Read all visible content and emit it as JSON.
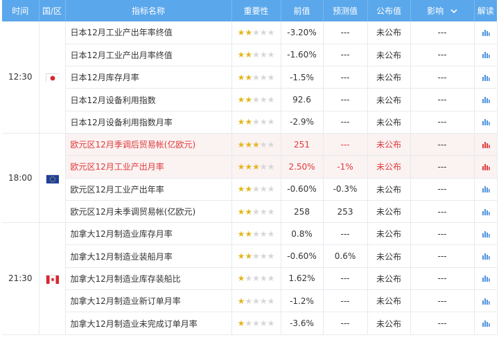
{
  "header": {
    "time": "时间",
    "region": "国/区",
    "indicator": "指标名称",
    "importance": "重要性",
    "previous": "前值",
    "forecast": "预测值",
    "actual": "公布值",
    "impact": "影响",
    "analysis": "解读"
  },
  "colors": {
    "header_bg": "#5aa7eb",
    "star_on": "#e2b71f",
    "highlight_text": "#e03a3a",
    "highlight_bg": "#fbf2f2",
    "icon_blue": "#4a8fe0"
  },
  "groups": [
    {
      "time": "12:30",
      "flag": "japan-flag-icon",
      "rows": [
        {
          "name": "日本12月工业产出年率终值",
          "stars": 2,
          "prev": "-3.20%",
          "fcst": "---",
          "actual": "未公布",
          "impact": "---",
          "hi": false
        },
        {
          "name": "日本12月工业产出月率终值",
          "stars": 2,
          "prev": "-1.60%",
          "fcst": "---",
          "actual": "未公布",
          "impact": "---",
          "hi": false
        },
        {
          "name": "日本12月库存月率",
          "stars": 2,
          "prev": "-1.5%",
          "fcst": "---",
          "actual": "未公布",
          "impact": "---",
          "hi": false
        },
        {
          "name": "日本12月设备利用指数",
          "stars": 2,
          "prev": "92.6",
          "fcst": "---",
          "actual": "未公布",
          "impact": "---",
          "hi": false
        },
        {
          "name": "日本12月设备利用指数月率",
          "stars": 2,
          "prev": "-2.9%",
          "fcst": "---",
          "actual": "未公布",
          "impact": "---",
          "hi": false
        }
      ]
    },
    {
      "time": "18:00",
      "flag": "eu-flag-icon",
      "rows": [
        {
          "name": "欧元区12月季调后贸易帐(亿欧元)",
          "stars": 3,
          "prev": "251",
          "fcst": "---",
          "actual": "未公布",
          "impact": "---",
          "hi": true
        },
        {
          "name": "欧元区12月工业产出月率",
          "stars": 3,
          "prev": "2.50%",
          "fcst": "-1%",
          "actual": "未公布",
          "impact": "---",
          "hi": true
        },
        {
          "name": "欧元区12月工业产出年率",
          "stars": 2,
          "prev": "-0.60%",
          "fcst": "-0.3%",
          "actual": "未公布",
          "impact": "---",
          "hi": false
        },
        {
          "name": "欧元区12月未季调贸易帐(亿欧元)",
          "stars": 2,
          "prev": "258",
          "fcst": "253",
          "actual": "未公布",
          "impact": "---",
          "hi": false
        }
      ]
    },
    {
      "time": "21:30",
      "flag": "canada-flag-icon",
      "rows": [
        {
          "name": "加拿大12月制造业库存月率",
          "stars": 2,
          "prev": "0.8%",
          "fcst": "---",
          "actual": "未公布",
          "impact": "---",
          "hi": false
        },
        {
          "name": "加拿大12月制造业装船月率",
          "stars": 2,
          "prev": "-0.60%",
          "fcst": "0.6%",
          "actual": "未公布",
          "impact": "---",
          "hi": false
        },
        {
          "name": "加拿大12月制造业库存装船比",
          "stars": 1,
          "prev": "1.62%",
          "fcst": "---",
          "actual": "未公布",
          "impact": "---",
          "hi": false
        },
        {
          "name": "加拿大12月制造业新订单月率",
          "stars": 1,
          "prev": "-1.2%",
          "fcst": "---",
          "actual": "未公布",
          "impact": "---",
          "hi": false
        },
        {
          "name": "加拿大12月制造业未完成订单月率",
          "stars": 1,
          "prev": "-3.6%",
          "fcst": "---",
          "actual": "未公布",
          "impact": "---",
          "hi": false
        }
      ]
    }
  ]
}
